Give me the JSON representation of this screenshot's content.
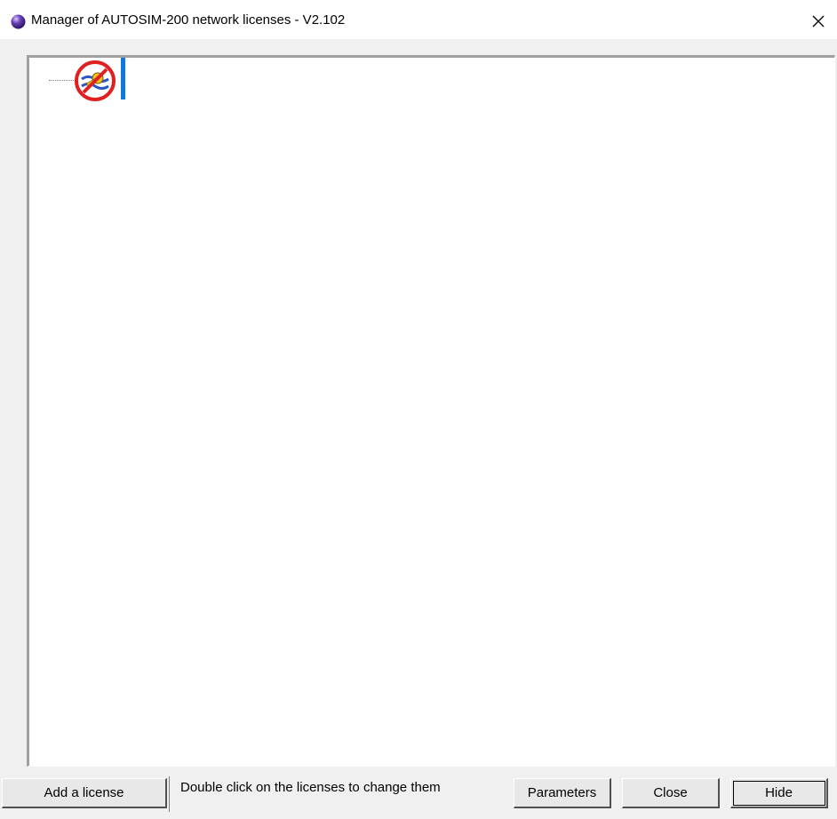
{
  "window": {
    "title": "Manager of AUTOSIM-200 network licenses - V2.102",
    "close_glyph": "×"
  },
  "tree": {
    "nodes": [
      {
        "icon": "no-license-key-icon",
        "label": ""
      }
    ]
  },
  "footer": {
    "add_license_label": "Add a license",
    "hint_text": "Double click on the licenses to change them",
    "parameters_label": "Parameters",
    "close_label": "Close",
    "hide_label": "Hide"
  },
  "colors": {
    "accent_selection": "#1177dd",
    "app_icon": "#6a3fb5",
    "prohibited": "#e02020"
  }
}
